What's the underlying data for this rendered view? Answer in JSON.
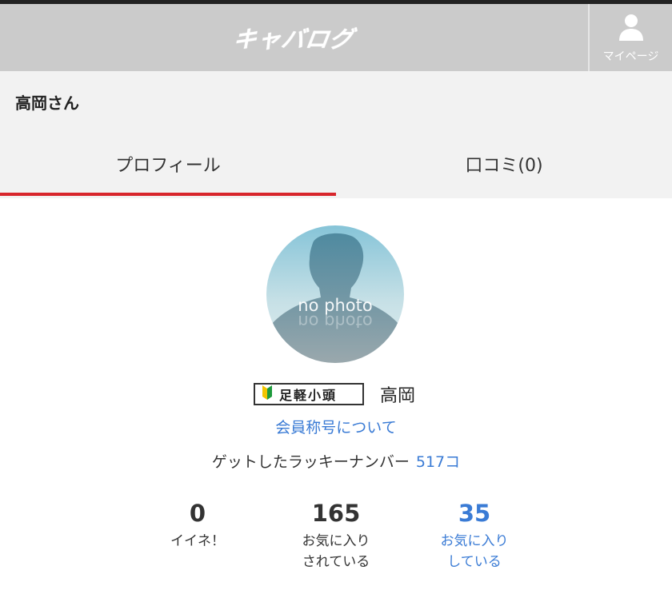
{
  "header": {
    "logo_text": "キャバログ",
    "mypage_label": "マイページ",
    "mypage_icon": "user-icon"
  },
  "profile": {
    "title": "高岡さん",
    "name": "高岡",
    "avatar_text": "no photo",
    "rank_badge": "足軽小頭",
    "rank_icon": "beginner-mark-icon",
    "member_title_link": "会員称号について",
    "lucky_label": "ゲットしたラッキーナンバー",
    "lucky_count": "517コ"
  },
  "tabs": [
    {
      "label": "プロフィール",
      "active": true
    },
    {
      "label": "口コミ(0)",
      "active": false
    }
  ],
  "stats": {
    "likes": {
      "value": "0",
      "label": "イイネ！"
    },
    "favorited": {
      "value": "165",
      "label_line1": "お気に入り",
      "label_line2": "されている"
    },
    "favoriting": {
      "value": "35",
      "label_line1": "お気に入り",
      "label_line2": "している"
    }
  },
  "colors": {
    "header_bg": "#cbcbcb",
    "accent_red": "#d8262c",
    "link_blue": "#3a7bd5"
  }
}
